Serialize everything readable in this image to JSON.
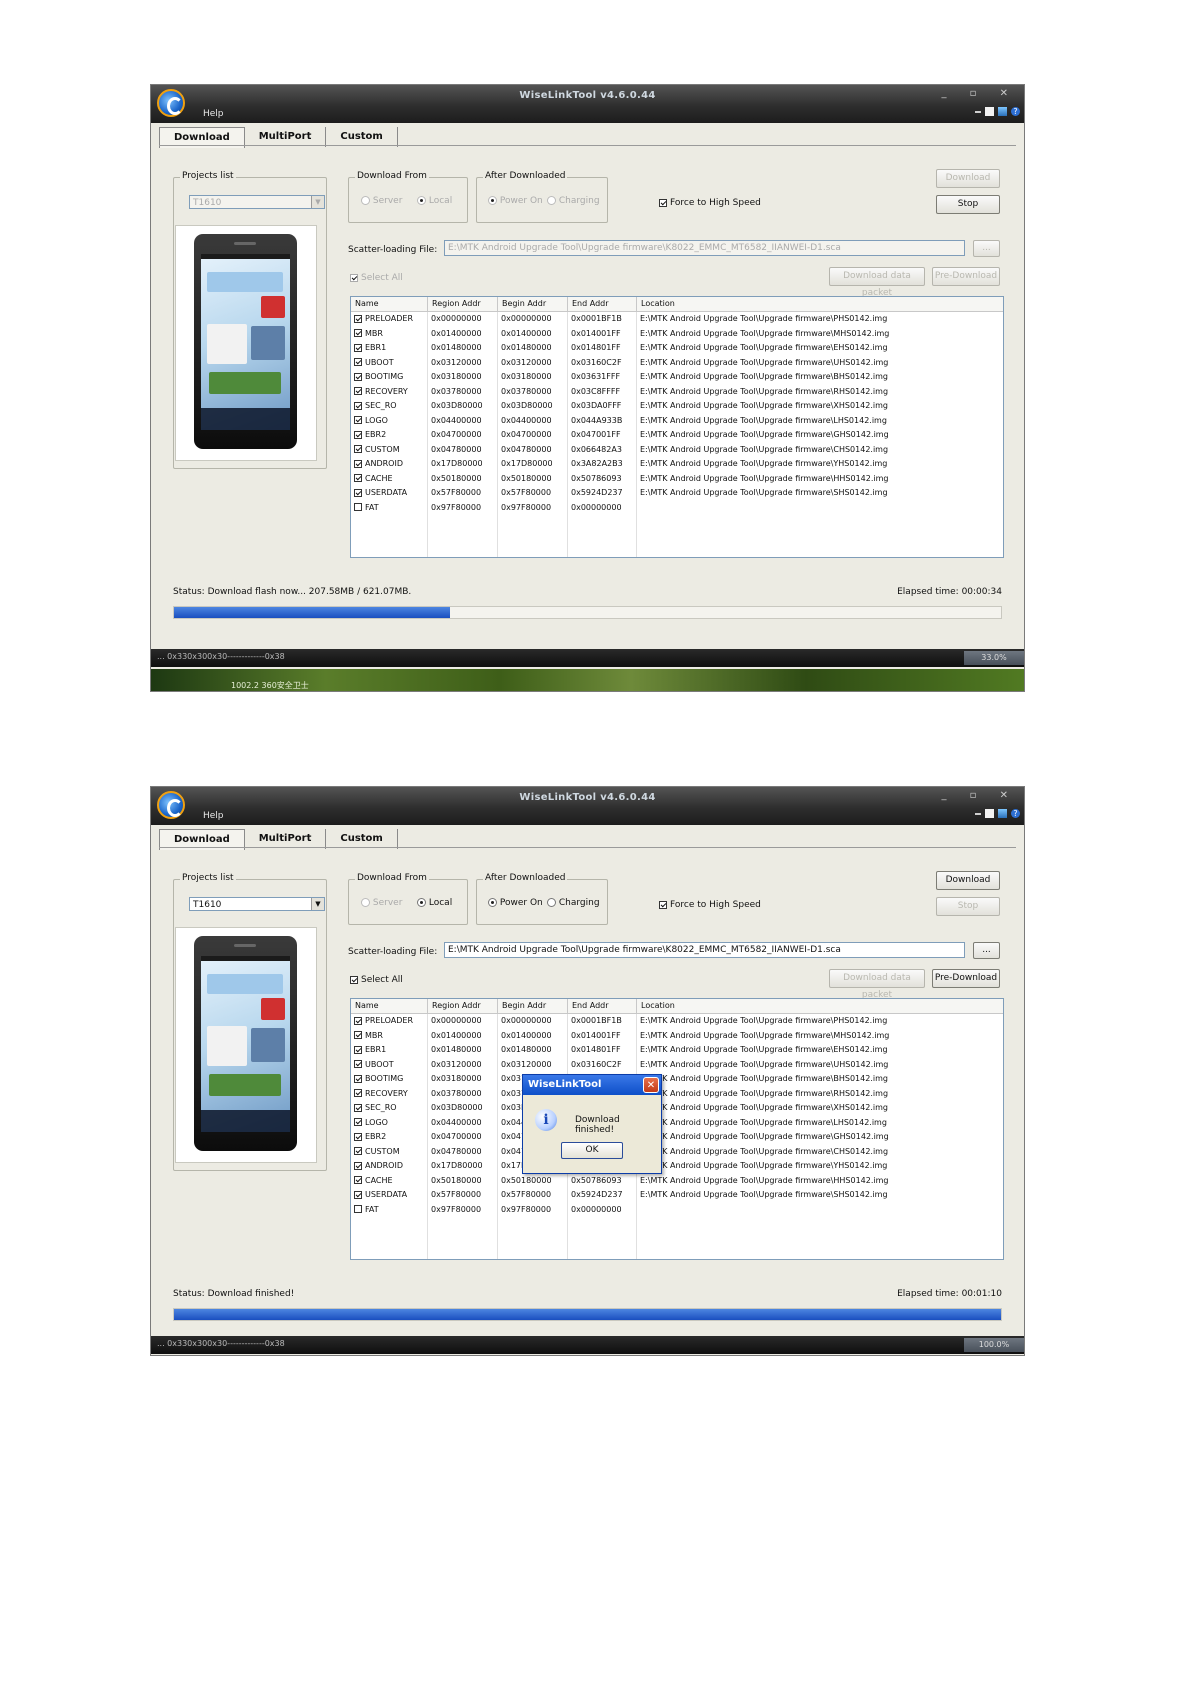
{
  "shot1": {
    "window_title": "WiseLinkTool v4.6.0.44",
    "help_menu": "Help",
    "tabs": [
      "Download",
      "MultiPort",
      "Custom"
    ],
    "projects_list_label": "Projects list",
    "project_selected": "T1610",
    "download_from_label": "Download From",
    "download_from_options": [
      "Server",
      "Local"
    ],
    "after_downloaded_label": "After Downloaded",
    "after_downloaded_options": [
      "Power On",
      "Charging"
    ],
    "force_high_speed_label": "Force to High Speed",
    "download_button": "Download",
    "stop_button": "Stop",
    "scatter_label": "Scatter-loading File:",
    "scatter_value": "E:\\MTK Android Upgrade Tool\\Upgrade firmware\\K8022_EMMC_MT6582_IIANWEI-D1.sca",
    "browse_button": "...",
    "select_all_label": "Select All",
    "download_data_packet_button": "Download data packet",
    "pre_download_button": "Pre-Download",
    "status_text": "Status:  Download flash now... 207.58MB / 621.07MB.",
    "elapsed_text": "Elapsed time: 00:00:34",
    "progress_fraction": 0.334,
    "taskbar_left": "... 0x330x300x30-------------0x38",
    "taskbar_right": "33.0%",
    "wallpaper_text": "1002.2      360安全卫士"
  },
  "shot2": {
    "window_title": "WiseLinkTool v4.6.0.44",
    "help_menu": "Help",
    "tabs": [
      "Download",
      "MultiPort",
      "Custom"
    ],
    "projects_list_label": "Projects list",
    "project_selected": "T1610",
    "download_from_label": "Download From",
    "download_from_options": [
      "Server",
      "Local"
    ],
    "after_downloaded_label": "After Downloaded",
    "after_downloaded_options": [
      "Power On",
      "Charging"
    ],
    "force_high_speed_label": "Force to High Speed",
    "download_button": "Download",
    "stop_button": "Stop",
    "scatter_label": "Scatter-loading File:",
    "scatter_value": "E:\\MTK Android Upgrade Tool\\Upgrade firmware\\K8022_EMMC_MT6582_IIANWEI-D1.sca",
    "browse_button": "...",
    "select_all_label": "Select All",
    "download_data_packet_button": "Download data packet",
    "pre_download_button": "Pre-Download",
    "status_text": "Status:  Download finished!",
    "elapsed_text": "Elapsed time: 00:01:10",
    "progress_fraction": 1.0,
    "taskbar_left": "... 0x330x300x30-------------0x38",
    "taskbar_right": "100.0%",
    "dialog": {
      "title": "WiseLinkTool",
      "message": "Download finished!",
      "ok_label": "OK"
    }
  },
  "table_headers": [
    "Name",
    "Region Addr",
    "Begin Addr",
    "End Addr",
    "Location"
  ],
  "table_rows": [
    {
      "checked": true,
      "name": "PRELOADER",
      "region": "0x00000000",
      "begin": "0x00000000",
      "end": "0x0001BF1B",
      "location": "E:\\MTK Android Upgrade Tool\\Upgrade firmware\\PHS0142.img"
    },
    {
      "checked": true,
      "name": "MBR",
      "region": "0x01400000",
      "begin": "0x01400000",
      "end": "0x014001FF",
      "location": "E:\\MTK Android Upgrade Tool\\Upgrade firmware\\MHS0142.img"
    },
    {
      "checked": true,
      "name": "EBR1",
      "region": "0x01480000",
      "begin": "0x01480000",
      "end": "0x014801FF",
      "location": "E:\\MTK Android Upgrade Tool\\Upgrade firmware\\EHS0142.img"
    },
    {
      "checked": true,
      "name": "UBOOT",
      "region": "0x03120000",
      "begin": "0x03120000",
      "end": "0x03160C2F",
      "location": "E:\\MTK Android Upgrade Tool\\Upgrade firmware\\UHS0142.img"
    },
    {
      "checked": true,
      "name": "BOOTIMG",
      "region": "0x03180000",
      "begin": "0x03180000",
      "end": "0x03631FFF",
      "location": "E:\\MTK Android Upgrade Tool\\Upgrade firmware\\BHS0142.img"
    },
    {
      "checked": true,
      "name": "RECOVERY",
      "region": "0x03780000",
      "begin": "0x03780000",
      "end": "0x03C8FFFF",
      "location": "E:\\MTK Android Upgrade Tool\\Upgrade firmware\\RHS0142.img"
    },
    {
      "checked": true,
      "name": "SEC_RO",
      "region": "0x03D80000",
      "begin": "0x03D80000",
      "end": "0x03DA0FFF",
      "location": "E:\\MTK Android Upgrade Tool\\Upgrade firmware\\XHS0142.img"
    },
    {
      "checked": true,
      "name": "LOGO",
      "region": "0x04400000",
      "begin": "0x04400000",
      "end": "0x044A933B",
      "location": "E:\\MTK Android Upgrade Tool\\Upgrade firmware\\LHS0142.img"
    },
    {
      "checked": true,
      "name": "EBR2",
      "region": "0x04700000",
      "begin": "0x04700000",
      "end": "0x047001FF",
      "location": "E:\\MTK Android Upgrade Tool\\Upgrade firmware\\GHS0142.img"
    },
    {
      "checked": true,
      "name": "CUSTOM",
      "region": "0x04780000",
      "begin": "0x04780000",
      "end": "0x066482A3",
      "location": "E:\\MTK Android Upgrade Tool\\Upgrade firmware\\CHS0142.img"
    },
    {
      "checked": true,
      "name": "ANDROID",
      "region": "0x17D80000",
      "begin": "0x17D80000",
      "end": "0x3A82A2B3",
      "location": "E:\\MTK Android Upgrade Tool\\Upgrade firmware\\YHS0142.img"
    },
    {
      "checked": true,
      "name": "CACHE",
      "region": "0x50180000",
      "begin": "0x50180000",
      "end": "0x50786093",
      "location": "E:\\MTK Android Upgrade Tool\\Upgrade firmware\\HHS0142.img"
    },
    {
      "checked": true,
      "name": "USERDATA",
      "region": "0x57F80000",
      "begin": "0x57F80000",
      "end": "0x5924D237",
      "location": "E:\\MTK Android Upgrade Tool\\Upgrade firmware\\SHS0142.img"
    },
    {
      "checked": false,
      "name": "FAT",
      "region": "0x97F80000",
      "begin": "0x97F80000",
      "end": "0x00000000",
      "location": ""
    }
  ],
  "colors": {
    "window_bg": "#ecebe3",
    "titlebar": "#2e2e2e",
    "progress": "#1a4fbf",
    "dialog_title": "#0d4fc8"
  }
}
